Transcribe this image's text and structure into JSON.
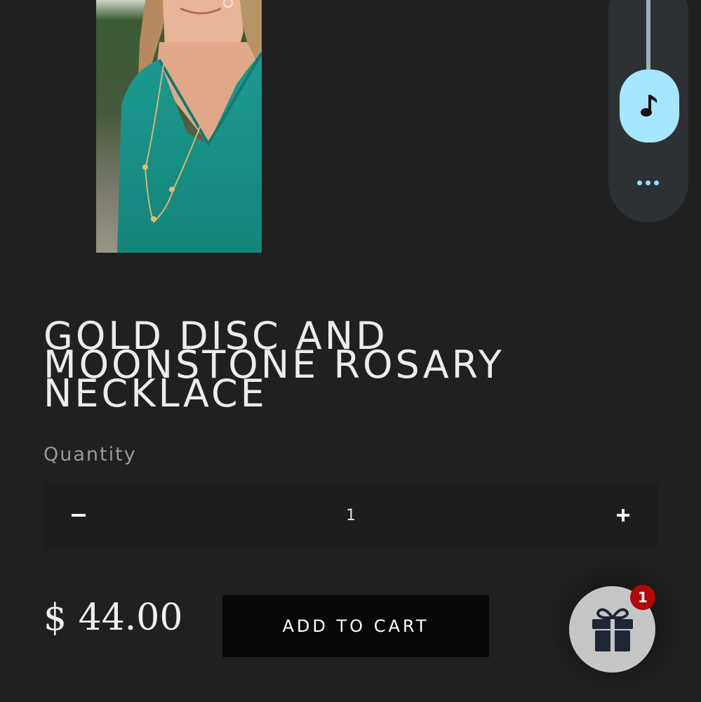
{
  "product": {
    "image_alt": "Woman wearing teal top and long gold disc and moonstone necklace",
    "title": "GOLD DISC AND MOONSTONE ROSARY NECKLACE",
    "quantity_label": "Quantity",
    "quantity_value": "1",
    "minus_symbol": "−",
    "plus_symbol": "+",
    "price": "$ 44.00",
    "add_to_cart_label": "ADD TO CART"
  },
  "music_widget": {
    "play_icon": "music-note-icon",
    "more_icon": "more-dots-icon",
    "accent_color": "#a7e6ff"
  },
  "gift_widget": {
    "icon": "gift-icon",
    "badge_count": "1",
    "badge_color": "#b0080c"
  }
}
